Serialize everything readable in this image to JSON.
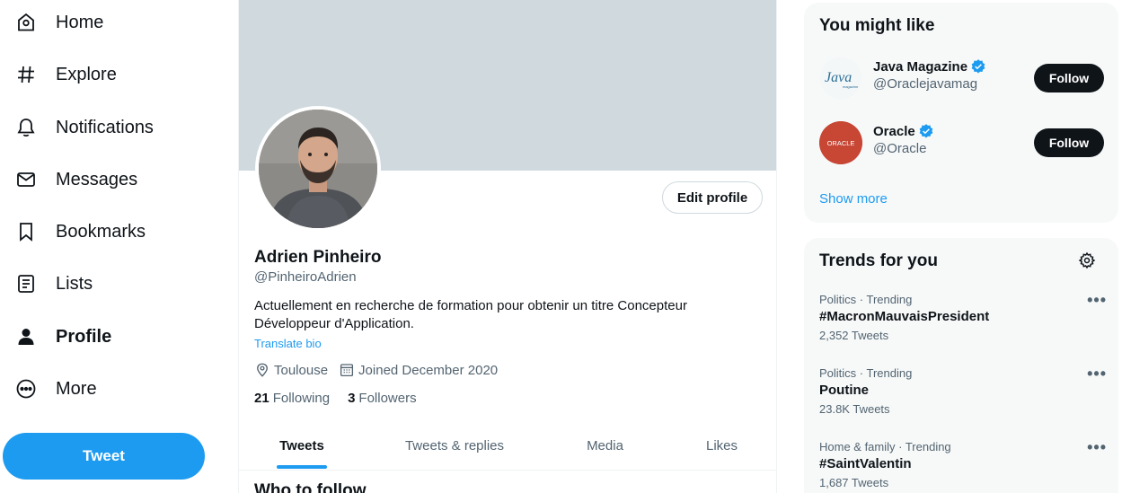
{
  "nav": {
    "items": [
      {
        "label": "Home",
        "icon": "home-icon"
      },
      {
        "label": "Explore",
        "icon": "hashtag-icon"
      },
      {
        "label": "Notifications",
        "icon": "bell-icon"
      },
      {
        "label": "Messages",
        "icon": "envelope-icon"
      },
      {
        "label": "Bookmarks",
        "icon": "bookmark-icon"
      },
      {
        "label": "Lists",
        "icon": "list-icon"
      },
      {
        "label": "Profile",
        "icon": "person-icon",
        "active": true
      },
      {
        "label": "More",
        "icon": "more-circle-icon"
      }
    ],
    "tweet_label": "Tweet"
  },
  "profile": {
    "name": "Adrien Pinheiro",
    "handle": "@PinheiroAdrien",
    "bio": "Actuellement en recherche de formation pour obtenir un titre Concepteur Développeur d'Application.",
    "translate_label": "Translate bio",
    "location": "Toulouse",
    "joined": "Joined December 2020",
    "following_count": "21",
    "following_label": "Following",
    "followers_count": "3",
    "followers_label": "Followers",
    "edit_label": "Edit profile",
    "banner_color": "#cfd9de"
  },
  "tabs": [
    {
      "label": "Tweets",
      "active": true
    },
    {
      "label": "Tweets & replies"
    },
    {
      "label": "Media"
    },
    {
      "label": "Likes"
    }
  ],
  "who_to_follow": "Who to follow",
  "you_might_like": {
    "title": "You might like",
    "accounts": [
      {
        "name": "Java Magazine",
        "handle": "@Oraclejavamag",
        "verified": true,
        "follow_label": "Follow",
        "logo_text": "Java",
        "logo_subtext": "magazine"
      },
      {
        "name": "Oracle",
        "handle": "@Oracle",
        "verified": true,
        "follow_label": "Follow",
        "logo_text": "ORACLE"
      }
    ],
    "show_more": "Show more"
  },
  "trends": {
    "title": "Trends for you",
    "items": [
      {
        "context": "Politics · Trending",
        "name": "#MacronMauvaisPresident",
        "count": "2,352 Tweets"
      },
      {
        "context": "Politics · Trending",
        "name": "Poutine",
        "count": "23.8K Tweets"
      },
      {
        "context": "Home & family · Trending",
        "name": "#SaintValentin",
        "count": "1,687 Tweets"
      }
    ]
  },
  "colors": {
    "accent": "#1d9bf0",
    "text": "#0f1419",
    "secondary": "#536471",
    "oracle_red": "#c74634"
  }
}
